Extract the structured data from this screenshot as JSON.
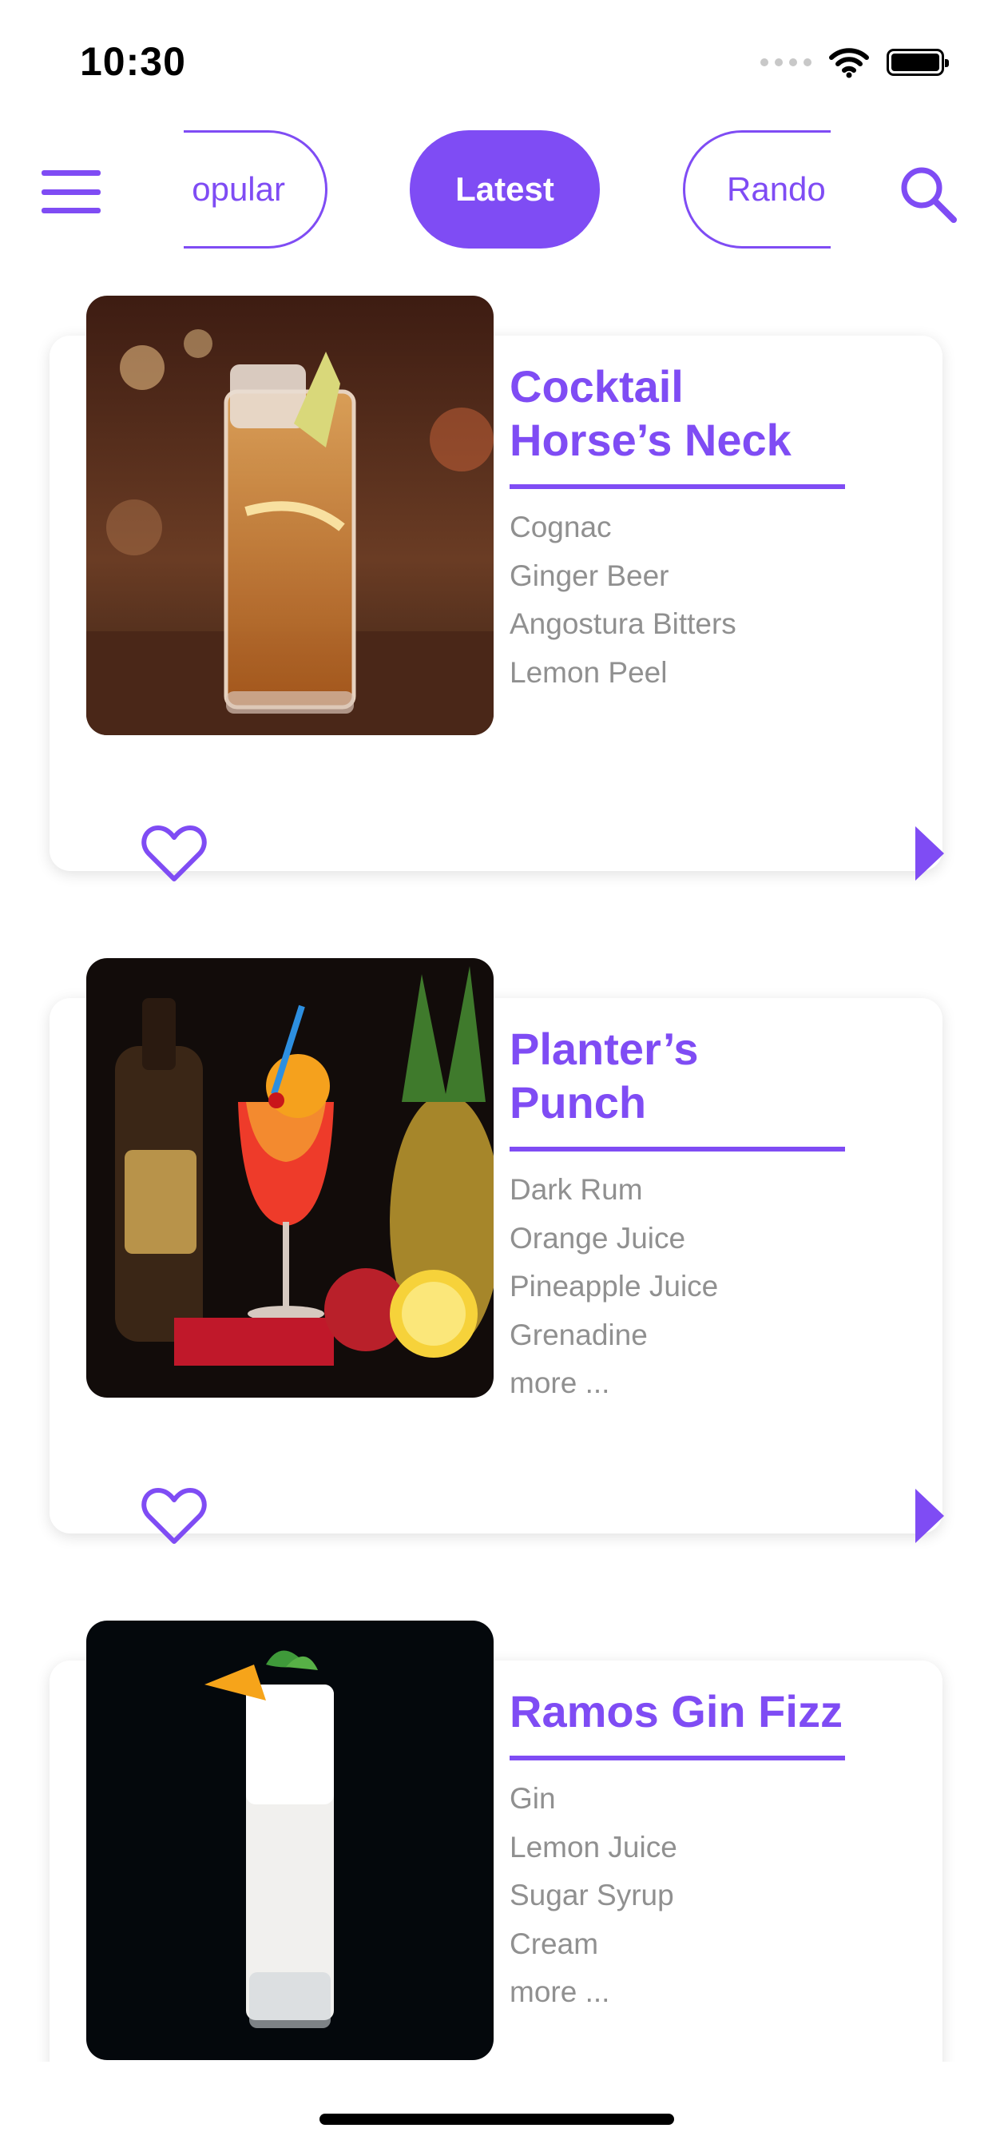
{
  "status_bar": {
    "time": "10:30",
    "icons": [
      "cellular-signal-icon",
      "wifi-icon",
      "battery-icon"
    ]
  },
  "nav": {
    "menu_icon": "hamburger-menu-icon",
    "search_icon": "search-icon",
    "tabs": [
      {
        "label": "Popular",
        "visible_text": "opular",
        "selected": false
      },
      {
        "label": "Latest",
        "visible_text": "Latest",
        "selected": true
      },
      {
        "label": "Random",
        "visible_text": "Rando",
        "selected": false
      }
    ]
  },
  "cocktails": [
    {
      "title": "Cocktail Horse’s Neck",
      "image": "iced-amber-highball-photo",
      "ingredients": [
        "Cognac",
        "Ginger Beer",
        "Angostura Bitters",
        "Lemon Peel"
      ],
      "more": ""
    },
    {
      "title": "Planter’s Punch",
      "image": "red-punch-with-pineapple-and-rum-bottle-photo",
      "ingredients": [
        "Dark Rum",
        "Orange Juice",
        "Pineapple Juice",
        "Grenadine"
      ],
      "more": "more ..."
    },
    {
      "title": "Ramos Gin Fizz",
      "image": "white-foamy-fizz-glass-photo",
      "ingredients": [
        "Gin",
        "Lemon Juice",
        "Sugar Syrup",
        "Cream"
      ],
      "more": "more ..."
    }
  ],
  "icons": {
    "favorite": "heart-outline-icon",
    "open": "play-arrow-icon"
  },
  "colors": {
    "accent": "#7f4cf4",
    "ingredient_text": "#909090",
    "background": "#ffffff"
  }
}
